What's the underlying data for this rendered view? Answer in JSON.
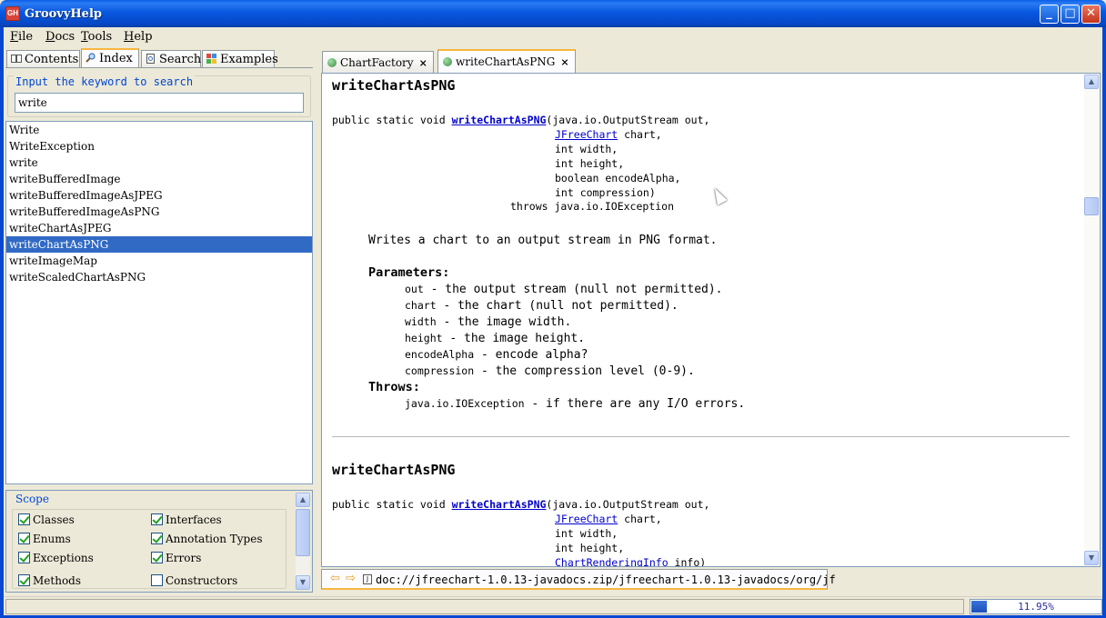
{
  "window": {
    "title": "GroovyHelp",
    "app_icon_text": "GH"
  },
  "menu": [
    "File",
    "Docs",
    "Tools",
    "Help"
  ],
  "left_tabs": [
    {
      "label": "Contents",
      "icon": "book-icon"
    },
    {
      "label": "Index",
      "icon": "magnifier-icon",
      "active": true
    },
    {
      "label": "Search",
      "icon": "document-search-icon"
    },
    {
      "label": "Examples",
      "icon": "puzzle-icon"
    }
  ],
  "search": {
    "legend": "Input the keyword to search",
    "value": "write"
  },
  "index_items": [
    "Write",
    "WriteException",
    "write",
    "writeBufferedImage",
    "writeBufferedImageAsJPEG",
    "writeBufferedImageAsPNG",
    "writeChartAsJPEG",
    "writeChartAsPNG",
    "writeImageMap",
    "writeScaledChartAsPNG"
  ],
  "selected_index": "writeChartAsPNG",
  "scope": {
    "title": "Scope",
    "options": [
      {
        "label": "Classes",
        "checked": true
      },
      {
        "label": "Interfaces",
        "checked": true
      },
      {
        "label": "Enums",
        "checked": true
      },
      {
        "label": "Annotation Types",
        "checked": true
      },
      {
        "label": "Exceptions",
        "checked": true
      },
      {
        "label": "Errors",
        "checked": true
      },
      {
        "label": "Methods",
        "checked": true
      },
      {
        "label": "Constructors",
        "checked": false
      }
    ]
  },
  "doc_tabs": [
    {
      "label": "ChartFactory",
      "close": "×"
    },
    {
      "label": "writeChartAsPNG",
      "close": "×",
      "active": true
    }
  ],
  "doc": {
    "method1": {
      "heading": "writeChartAsPNG",
      "sig_prefix": "public static void ",
      "sig_name": "writeChartAsPNG",
      "sig_line1_rest": "(java.io.OutputStream out,",
      "sig_jfree": "JFreeChart",
      "sig_jfree_rest": " chart,",
      "sig_width": "int width,",
      "sig_height": "int height,",
      "sig_encode": "boolean encodeAlpha,",
      "sig_compression": "int compression)",
      "sig_throws": "throws java.io.IOException",
      "description": "Writes a chart to an output stream in PNG format.",
      "parameters_label": "Parameters:",
      "params": [
        {
          "name": "out",
          "text": " - the output stream (null not permitted)."
        },
        {
          "name": "chart",
          "text": " - the chart (null not permitted)."
        },
        {
          "name": "width",
          "text": " - the image width."
        },
        {
          "name": "height",
          "text": " - the image height."
        },
        {
          "name": "encodeAlpha",
          "text": " - encode alpha?"
        },
        {
          "name": "compression",
          "text": " - the compression level (0-9)."
        }
      ],
      "throws_label": "Throws:",
      "throws_item": {
        "name": "java.io.IOException",
        "text": " - if there are any I/O errors."
      }
    },
    "method2": {
      "heading": "writeChartAsPNG",
      "sig_prefix": "public static void ",
      "sig_name": "writeChartAsPNG",
      "sig_line1_rest": "(java.io.OutputStream out,",
      "sig_jfree": "JFreeChart",
      "sig_jfree_rest": " chart,",
      "sig_width": "int width,",
      "sig_height": "int height,",
      "sig_info": "ChartRenderingInfo",
      "sig_info_rest": " info)"
    }
  },
  "address": {
    "back": "⇦",
    "forward": "⇨",
    "url": "doc://jfreechart-1.0.13-javadocs.zip/jfreechart-1.0.13-javadocs/org/jf"
  },
  "status": {
    "progress_text": "11.95%",
    "progress_value": 11.95
  },
  "colors": {
    "accent_tab": "#F7B63E",
    "selection": "#316AC5",
    "link": "#0000CC"
  }
}
